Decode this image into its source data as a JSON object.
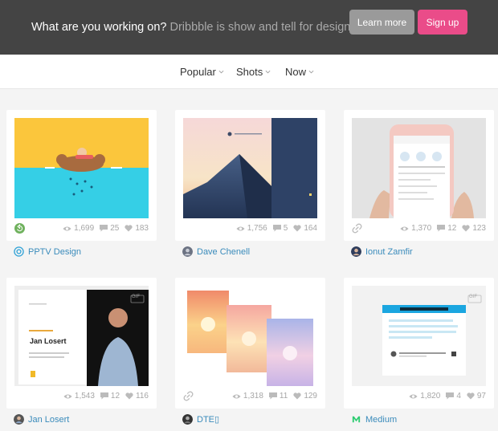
{
  "banner": {
    "prompt": "What are you working on?",
    "tagline": "Dribbble is show and tell for designers.",
    "learn_more": "Learn more",
    "sign_up": "Sign up"
  },
  "filters": [
    {
      "label": "Popular"
    },
    {
      "label": "Shots"
    },
    {
      "label": "Now"
    }
  ],
  "shots": [
    {
      "views": "1,699",
      "comments": "25",
      "likes": "183",
      "author": "PPTV Design",
      "left_icon": "rebound-icon"
    },
    {
      "views": "1,756",
      "comments": "5",
      "likes": "164",
      "author": "Dave Chenell"
    },
    {
      "views": "1,370",
      "comments": "12",
      "likes": "123",
      "author": "Ionut Zamfir",
      "left_icon": "link-icon"
    },
    {
      "views": "1,543",
      "comments": "12",
      "likes": "116",
      "author": "Jan Losert",
      "badge": "GIF",
      "name_text": "Jan Losert"
    },
    {
      "views": "1,318",
      "comments": "11",
      "likes": "129",
      "author": "DTE▯",
      "left_icon": "link-icon"
    },
    {
      "views": "1,820",
      "comments": "4",
      "likes": "97",
      "author": "Medium",
      "badge": "GIF"
    }
  ],
  "colors": {
    "accent": "#ea4c89",
    "banner": "#444444",
    "link": "#3a8bbb"
  }
}
